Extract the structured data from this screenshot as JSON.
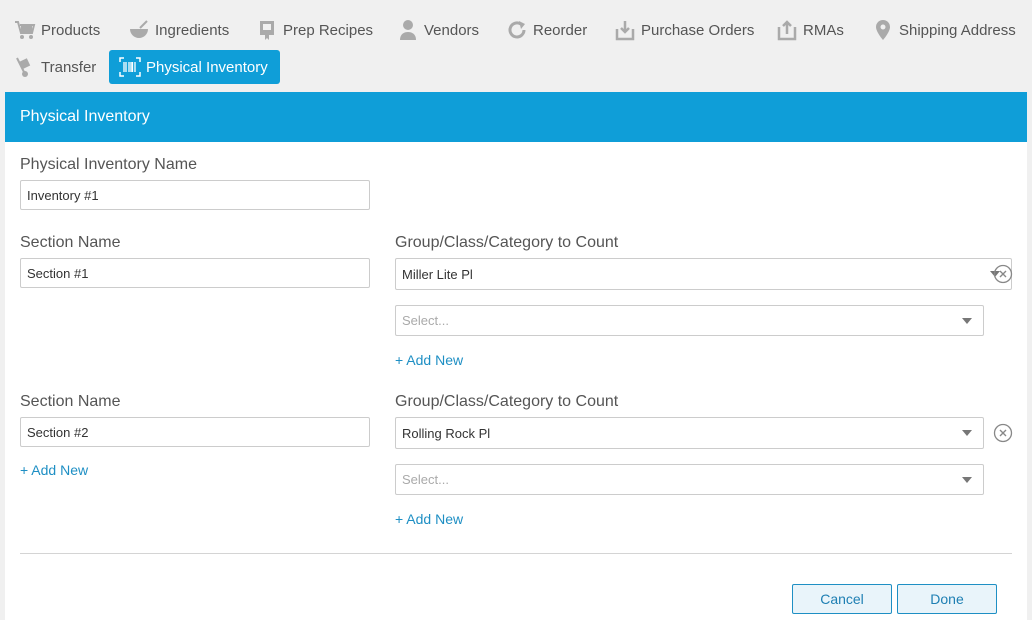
{
  "nav": {
    "items": [
      {
        "label": "Products",
        "icon": "cart-icon"
      },
      {
        "label": "Ingredients",
        "icon": "bowl-icon"
      },
      {
        "label": "Prep Recipes",
        "icon": "recipe-icon"
      },
      {
        "label": "Vendors",
        "icon": "person-icon"
      },
      {
        "label": "Reorder",
        "icon": "refresh-icon"
      },
      {
        "label": "Purchase Orders",
        "icon": "inbox-download-icon"
      },
      {
        "label": "RMAs",
        "icon": "upload-icon"
      },
      {
        "label": "Shipping Address",
        "icon": "map-pin-icon"
      },
      {
        "label": "Transfer",
        "icon": "hand-truck-icon"
      },
      {
        "label": "Physical Inventory",
        "icon": "barcode-icon",
        "active": true
      }
    ]
  },
  "panel": {
    "title": "Physical Inventory",
    "name_label": "Physical Inventory Name",
    "name_value": "Inventory #1",
    "sections": [
      {
        "section_label": "Section Name",
        "section_value": "Section #1",
        "group_label": "Group/Class/Category to Count",
        "selected": "Miller Lite Pl",
        "select_placeholder": "Select...",
        "add_new": "+ Add New"
      },
      {
        "section_label": "Section Name",
        "section_value": "Section #2",
        "group_label": "Group/Class/Category to Count",
        "selected": "Rolling Rock Pl",
        "select_placeholder": "Select...",
        "add_new": "+ Add New"
      }
    ],
    "add_section": "+ Add New",
    "cancel": "Cancel",
    "done": "Done"
  },
  "colors": {
    "accent": "#0f9ed8",
    "link": "#1e8fc4"
  }
}
